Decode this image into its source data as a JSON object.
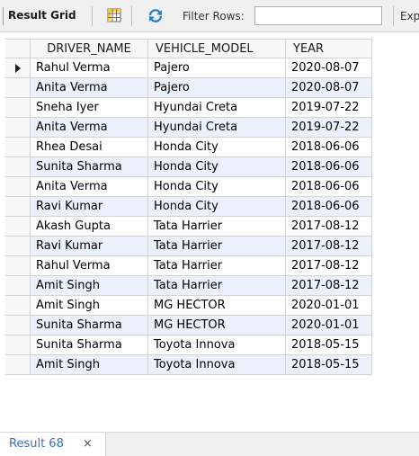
{
  "toolbar": {
    "result_grid_label": "Result Grid",
    "filter_label": "Filter Rows:",
    "filter_value": "",
    "export_label": "Exp"
  },
  "grid": {
    "columns": [
      "",
      "DRIVER_NAME",
      "VEHICLE_MODEL",
      "YEAR"
    ],
    "selected_row": 0,
    "rows": [
      [
        "Rahul Verma",
        "Pajero",
        "2020-08-07"
      ],
      [
        "Anita Verma",
        "Pajero",
        "2020-08-07"
      ],
      [
        "Sneha Iyer",
        "Hyundai Creta",
        "2019-07-22"
      ],
      [
        "Anita Verma",
        "Hyundai Creta",
        "2019-07-22"
      ],
      [
        "Rhea Desai",
        "Honda City",
        "2018-06-06"
      ],
      [
        "Sunita Sharma",
        "Honda City",
        "2018-06-06"
      ],
      [
        "Anita Verma",
        "Honda City",
        "2018-06-06"
      ],
      [
        "Ravi Kumar",
        "Honda City",
        "2018-06-06"
      ],
      [
        "Akash Gupta",
        " Tata Harrier",
        "2017-08-12"
      ],
      [
        "Ravi Kumar",
        " Tata Harrier",
        "2017-08-12"
      ],
      [
        "Rahul Verma",
        " Tata Harrier",
        "2017-08-12"
      ],
      [
        "Amit Singh",
        " Tata Harrier",
        "2017-08-12"
      ],
      [
        "Amit Singh",
        "MG HECTOR",
        "2020-01-01"
      ],
      [
        "Sunita Sharma",
        "MG HECTOR",
        "2020-01-01"
      ],
      [
        "Sunita Sharma",
        "Toyota Innova",
        "2018-05-15"
      ],
      [
        "Amit Singh",
        "Toyota Innova",
        "2018-05-15"
      ]
    ]
  },
  "status": {
    "tab_label": "Result 68",
    "close_glyph": "×"
  },
  "icons": {
    "grid": "grid-view-icon",
    "refresh": "refresh-icon",
    "row_indicator": "current-row-icon",
    "close": "close-icon"
  }
}
